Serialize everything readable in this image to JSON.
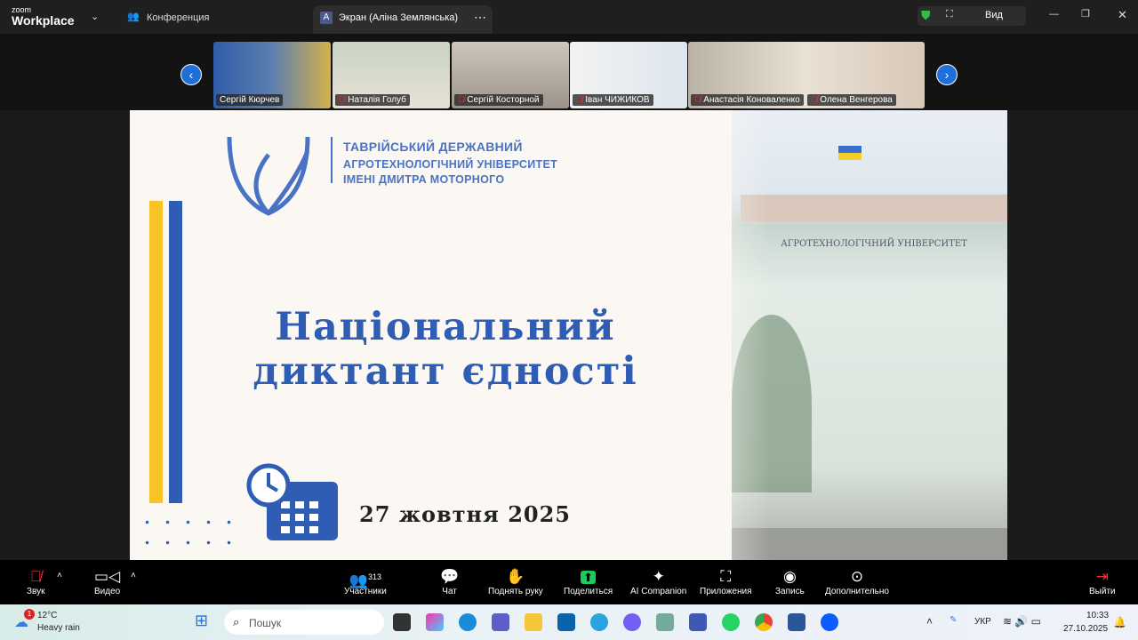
{
  "titlebar": {
    "logo_small": "zoom",
    "logo_big": "Workplace",
    "meeting_label": "Конференция",
    "screen_tab_avatar": "A",
    "screen_tab": "Экран (Аліна Землянська)",
    "view_label": "Вид"
  },
  "gallery": {
    "participants": [
      "Сергій Кюрчев",
      "Наталія Голуб",
      "Сергій Косторной",
      "Іван ЧИЖИКОВ",
      "Анастасія Коноваленко",
      "Олена Венгерова"
    ]
  },
  "slide": {
    "uni_lines": [
      "ТАВРІЙСЬКИЙ ДЕРЖАВНИЙ",
      "АГРОТЕХНОЛОГІЧНИЙ УНІВЕРСИТЕТ",
      "ІМЕНІ ДМИТРА МОТОРНОГО"
    ],
    "title_line1": "Національний",
    "title_line2": "диктант єдності",
    "date": "27 жовтня 2025",
    "building_sign": "АГРОТЕХНОЛОГІЧНИЙ УНІВЕРСИТЕТ"
  },
  "toolbar": {
    "audio": "Звук",
    "video": "Видео",
    "participants": "Участники",
    "participants_count": "313",
    "chat": "Чат",
    "raise_hand": "Поднять руку",
    "share": "Поделиться",
    "ai": "AI Companion",
    "apps": "Приложения",
    "record": "Запись",
    "more": "Дополнительно",
    "leave": "Выйти"
  },
  "taskbar": {
    "temp": "12°C",
    "weather": "Heavy rain",
    "badge": "1",
    "search": "Пошук",
    "lang": "УКР",
    "time": "10:33",
    "date": "27.10.2025"
  },
  "colors": {
    "accent": "#1e6fd9",
    "slide_blue": "#2e5db3",
    "yellow": "#f7c325"
  }
}
